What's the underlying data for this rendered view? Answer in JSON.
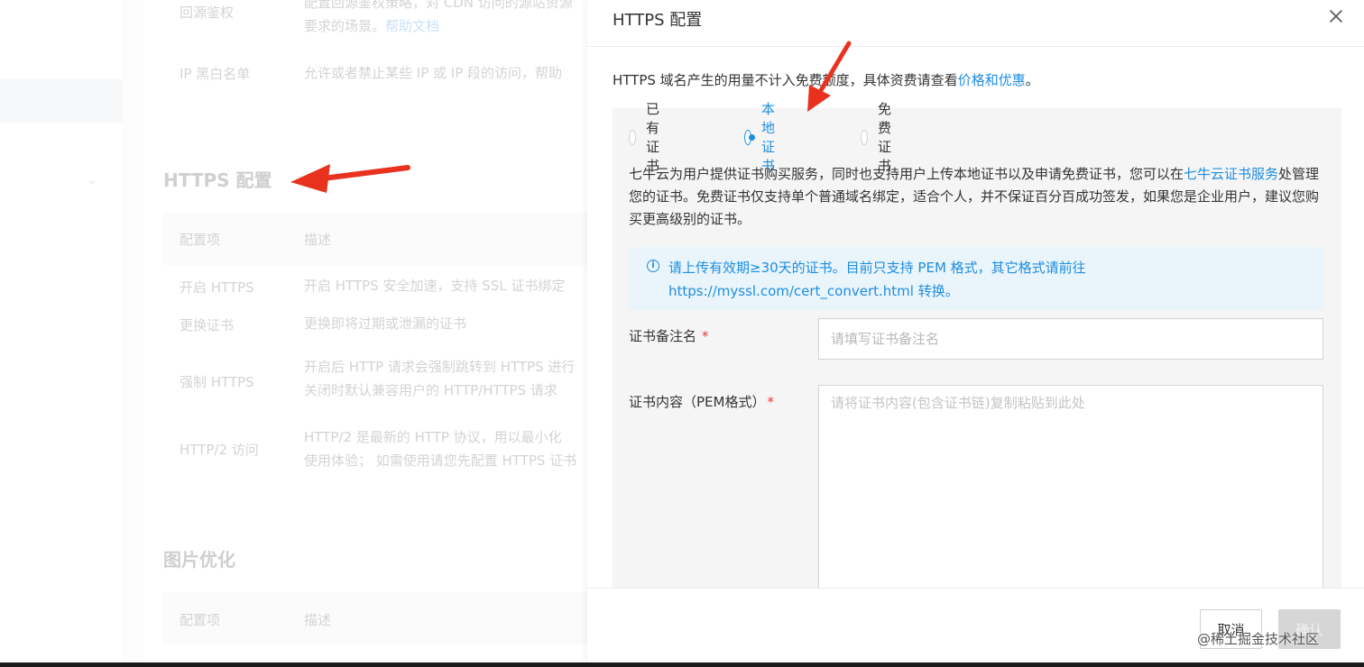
{
  "background": {
    "rows_top": [
      {
        "label": "回源鉴权",
        "desc_lines": [
          "配置回源鉴权策略，对 CDN 访问的源站资源",
          "要求的场景。"
        ],
        "link": "帮助文档"
      },
      {
        "label": "IP 黑白名单",
        "desc_lines": [
          "允许或者禁止某些 IP 或 IP 段的访问，帮助"
        ]
      }
    ],
    "https_section": {
      "title": "HTTPS 配置",
      "col_item": "配置项",
      "col_desc": "描述",
      "rows": [
        {
          "label": "开启 HTTPS",
          "desc_lines": [
            "开启 HTTPS 安全加速，支持 SSL 证书绑定"
          ]
        },
        {
          "label": "更换证书",
          "desc_lines": [
            "更换即将过期或泄漏的证书"
          ]
        },
        {
          "label": "强制 HTTPS",
          "desc_lines": [
            "开启后 HTTP 请求会强制跳转到 HTTPS 进行",
            "关闭时默认兼容用户的 HTTP/HTTPS 请求"
          ]
        },
        {
          "label": "HTTP/2 访问",
          "desc_lines": [
            "HTTP/2 是最新的 HTTP 协议，用以最小化",
            "使用体验； 如需使用请您先配置 HTTPS 证书"
          ]
        }
      ]
    },
    "image_section": {
      "title": "图片优化",
      "col_item": "配置项",
      "col_desc": "描述"
    },
    "arrow_color": "#e8321e"
  },
  "drawer": {
    "title": "HTTPS 配置",
    "close_icon": "close-icon",
    "intro_text": "HTTPS 域名产生的用量不计入免费额度，具体资费请查看",
    "intro_link": "价格和优惠",
    "intro_end": "。",
    "radio_options": [
      {
        "label": "已有证书",
        "checked": false
      },
      {
        "label": "本地证书",
        "checked": true
      },
      {
        "label": "免费证书",
        "checked": false
      }
    ],
    "description_pre": "七牛云为用户提供证书购买服务，同时也支持用户上传本地证书以及申请免费证书，您可以在",
    "description_link": "七牛云证书服务",
    "description_post": "处管理您的证书。免费证书仅支持单个普通域名绑定，适合个人，并不保证百分百成功签发，如果您是企业用户，建议您购买更高级别的证书。",
    "notice_line1": "请上传有效期≥30天的证书。目前只支持 PEM 格式，其它格式请前往",
    "notice_line2": "https://myssl.com/cert_convert.html 转换。",
    "cert_name_label": "证书备注名",
    "cert_name_placeholder": "请填写证书备注名",
    "cert_content_label": "证书内容（PEM格式）",
    "cert_content_placeholder": "请将证书内容(包含证书链)复制粘贴到此处",
    "required_mark": "*",
    "cancel_label": "取消",
    "ok_label": "确认",
    "accent_color": "#1f8ee0"
  },
  "watermark": "@稀土掘金技术社区"
}
